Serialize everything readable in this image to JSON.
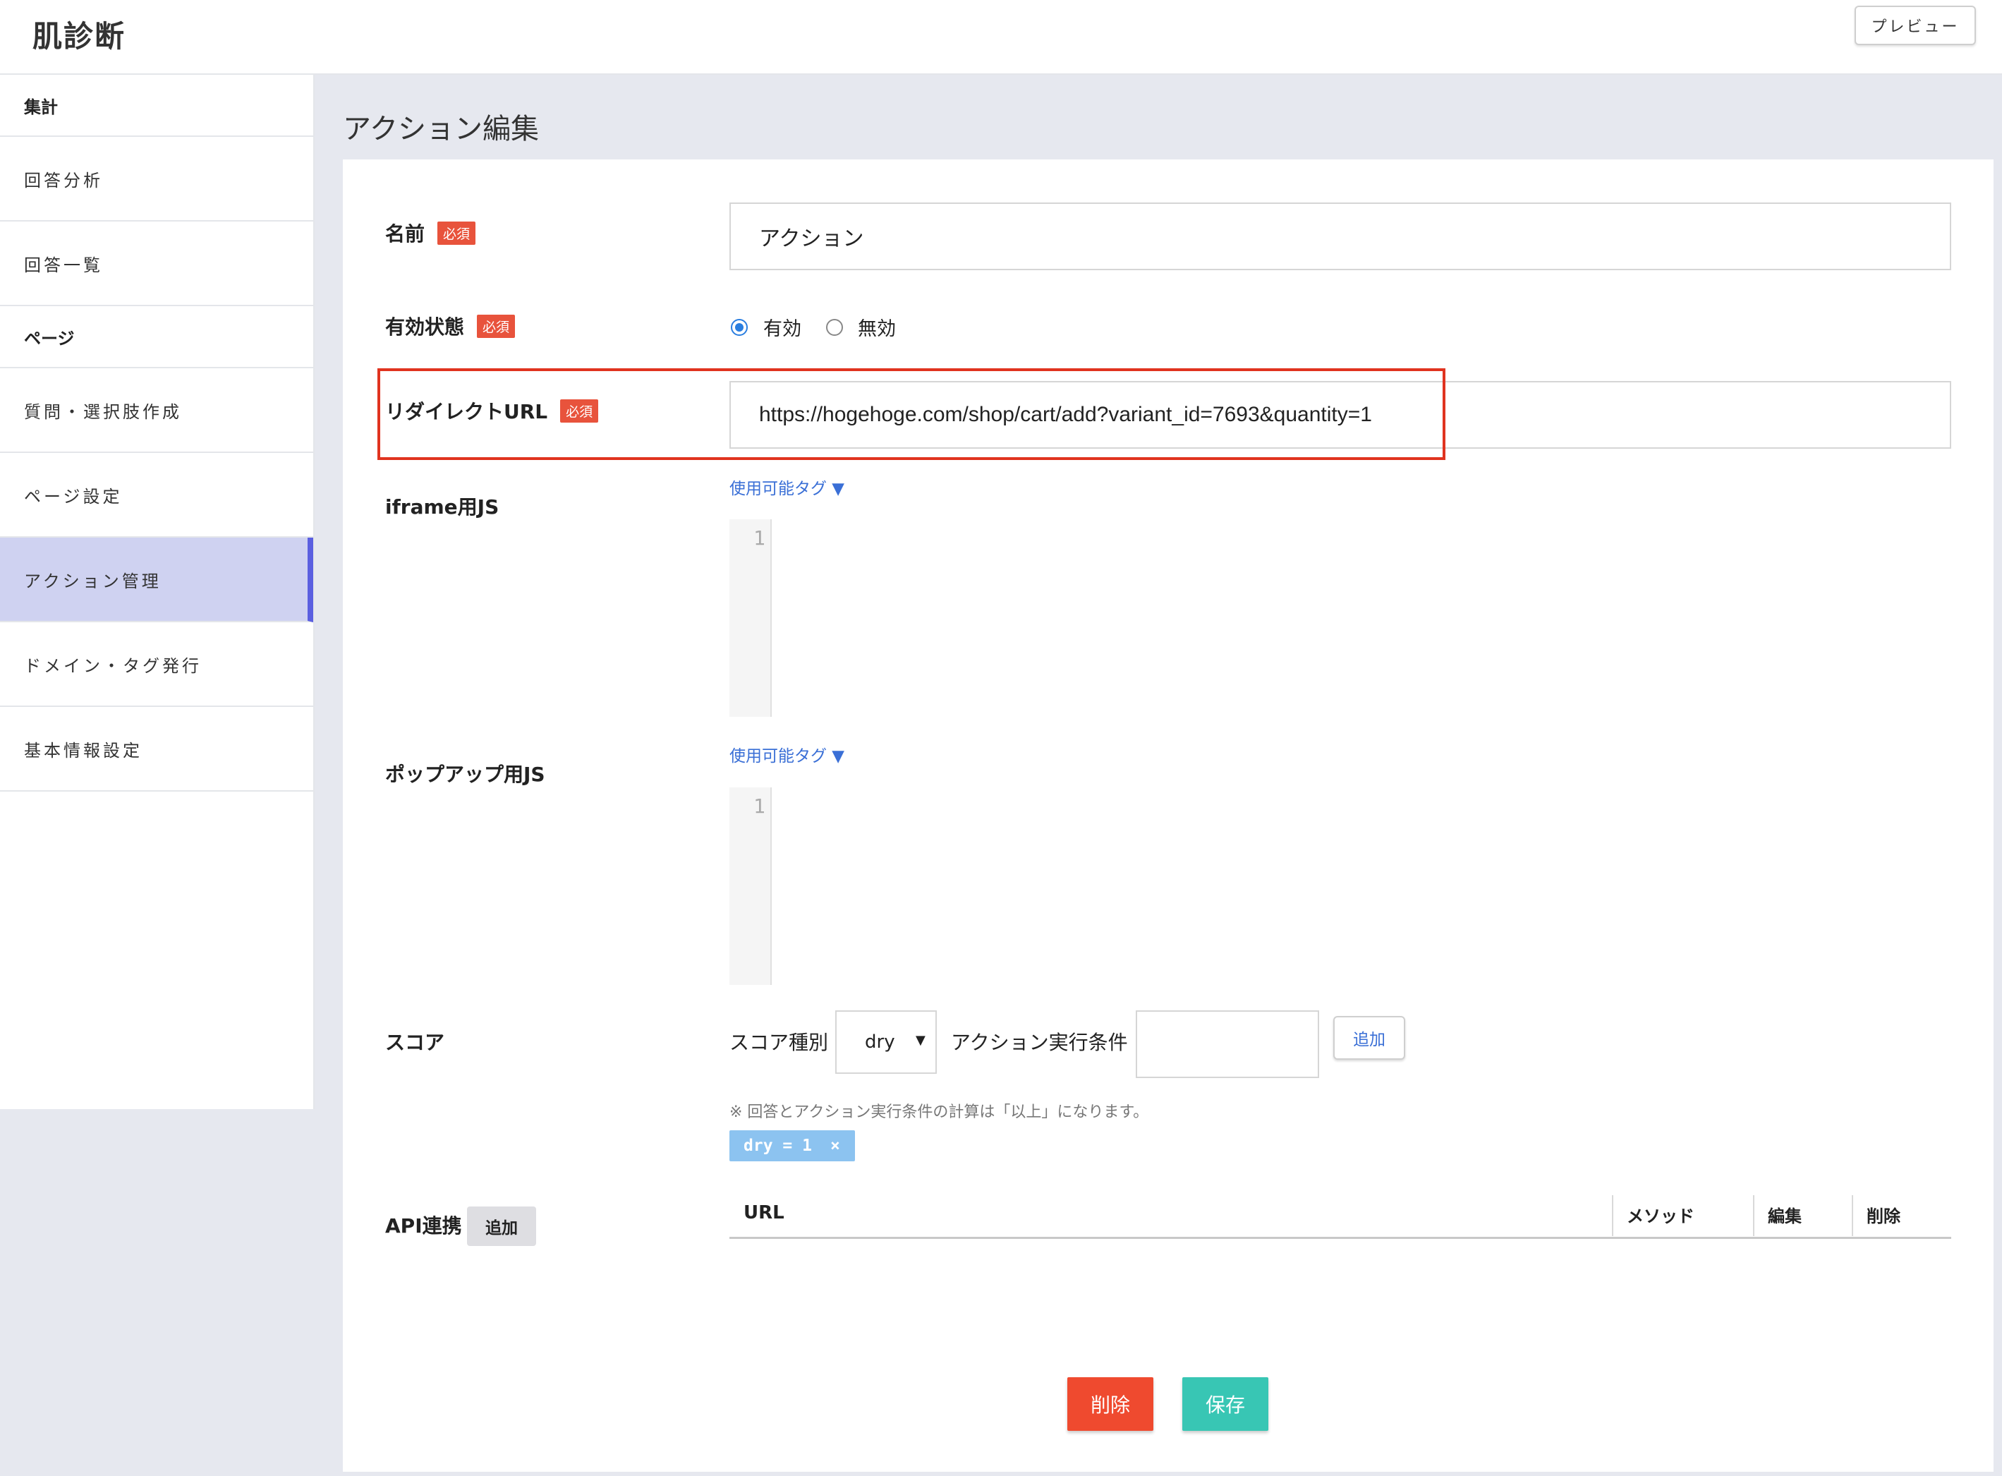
{
  "header": {
    "app_title": "肌診断",
    "preview_label": "プレビュー"
  },
  "sidebar": {
    "sections": [
      {
        "title": "集計",
        "items": [
          "回答分析",
          "回答一覧"
        ]
      },
      {
        "title": "ページ",
        "items": [
          "質問・選択肢作成",
          "ページ設定",
          "アクション管理",
          "ドメイン・タグ発行",
          "基本情報設定"
        ]
      }
    ],
    "active_item": "アクション管理"
  },
  "page": {
    "title": "アクション編集"
  },
  "required_badge": "必須",
  "form": {
    "name": {
      "label": "名前",
      "value": "アクション"
    },
    "status": {
      "label": "有効状態",
      "options": [
        "有効",
        "無効"
      ],
      "selected": "有効"
    },
    "redirect_url": {
      "label": "リダイレクトURL",
      "value": "https://hogehoge.com/shop/cart/add?variant_id=7693&quantity=1"
    },
    "iframe_js": {
      "label": "iframe用JS",
      "tag_link": "使用可能タグ ▼",
      "line_number": "1"
    },
    "popup_js": {
      "label": "ポップアップ用JS",
      "tag_link": "使用可能タグ ▼",
      "line_number": "1"
    },
    "score": {
      "label": "スコア",
      "type_label": "スコア種別",
      "type_value": "dry",
      "condition_label": "アクション実行条件",
      "condition_value": "",
      "add_label": "追加",
      "note": "※ 回答とアクション実行条件の計算は「以上」になります。",
      "chip": "dry = 1",
      "chip_remove": "×"
    },
    "api": {
      "label": "API連携",
      "add_label": "追加",
      "columns": [
        "URL",
        "メソッド",
        "編集",
        "削除"
      ]
    }
  },
  "actions": {
    "delete_label": "削除",
    "save_label": "保存"
  },
  "colors": {
    "accent": "#5b5fe0",
    "required": "#e8533c",
    "delete": "#ef4a2f",
    "save": "#38c6b4",
    "highlight": "#e0331f"
  }
}
